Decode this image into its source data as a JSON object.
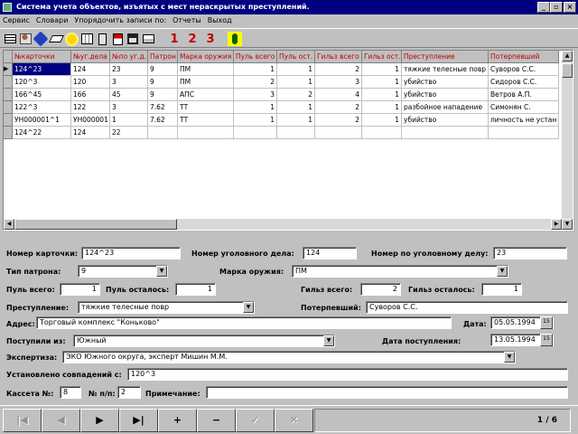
{
  "window": {
    "title": "Система учета объектов, изъятых с мест нераскрытых преступлений."
  },
  "menu": [
    "Сервис",
    "Словари",
    "Упорядочить записи по:",
    "Отчеты",
    "Выход"
  ],
  "grid": {
    "columns": [
      "№карточки",
      "№уг.дела",
      "№по уг.д.",
      "Патрон",
      "Марка оружия",
      "Пуль всего",
      "Пуль ост.",
      "Гильз всего",
      "Гильз ост.",
      "Преступление",
      "Потерпевший"
    ],
    "rows": [
      [
        "124^23",
        "124",
        "23",
        "9",
        "ПМ",
        "1",
        "1",
        "2",
        "1",
        "тяжкие телесные повр",
        "Суворов С.С."
      ],
      [
        "120^3",
        "120",
        "3",
        "9",
        "ПМ",
        "2",
        "1",
        "3",
        "1",
        "убийство",
        "Сидоров С.С."
      ],
      [
        "166^45",
        "166",
        "45",
        "9",
        "АПС",
        "3",
        "2",
        "4",
        "1",
        "убийство",
        "Ветров А.П."
      ],
      [
        "122^3",
        "122",
        "3",
        "7.62",
        "ТТ",
        "1",
        "1",
        "2",
        "1",
        "разбойное нападение",
        "Симонян С."
      ],
      [
        "УН000001^1",
        "УН000001",
        "1",
        "7.62",
        "ТТ",
        "1",
        "1",
        "2",
        "1",
        "убийство",
        "личность не устан"
      ],
      [
        "124^22",
        "124",
        "22",
        "",
        "",
        "",
        "",
        "",
        "",
        "",
        ""
      ]
    ]
  },
  "form": {
    "card_no": {
      "label": "Номер карточки:",
      "value": "124^23"
    },
    "case_no": {
      "label": "Номер уголовного дела:",
      "value": "124"
    },
    "num_in_case": {
      "label": "Номер по уголовному делу:",
      "value": "23"
    },
    "cartridge": {
      "label": "Тип патрона:",
      "value": "9"
    },
    "weapon": {
      "label": "Марка оружия:",
      "value": "ПМ"
    },
    "bullets_total": {
      "label": "Пуль всего:",
      "value": "1"
    },
    "bullets_left": {
      "label": "Пуль осталось:",
      "value": "1"
    },
    "shells_total": {
      "label": "Гильз всего:",
      "value": "2"
    },
    "shells_left": {
      "label": "Гильз осталось:",
      "value": "1"
    },
    "crime": {
      "label": "Преступление:",
      "value": "тяжкие телесные повр"
    },
    "victim": {
      "label": "Потерпевший:",
      "value": "Суворов С.С."
    },
    "address": {
      "label": "Адрес:",
      "value": "Торговый комплекс \"Коньково\""
    },
    "date": {
      "label": "Дата:",
      "value": "05.05.1994"
    },
    "received_from": {
      "label": "Поступили из:",
      "value": "Южный"
    },
    "received_date": {
      "label": "Дата поступления:",
      "value": "13.05.1994"
    },
    "expertise": {
      "label": "Экспертиза:",
      "value": "ЭКО Южного округа, эксперт Мишин М.М."
    },
    "matches": {
      "label": "Установлено совпадений с:",
      "value": "120^3"
    },
    "cassette": {
      "label": "Кассета №:",
      "value": "8"
    },
    "pos": {
      "label": "№ п/п:",
      "value": "2"
    },
    "note": {
      "label": "Примечание:",
      "value": ""
    }
  },
  "nav": {
    "first": "|◀",
    "prior": "◀",
    "next": "▶",
    "last": "▶|",
    "insert": "+",
    "delete": "−",
    "post": "✓",
    "cancel": "✕",
    "page": "1 / 6"
  },
  "toolbar": {
    "icons": [
      "table-icon",
      "people-icon",
      "edit-icon",
      "eraser-icon",
      "sun-icon",
      "calendar-icon",
      "calculator-icon",
      "document-icon",
      "save-icon",
      "print-icon",
      "report-1-icon",
      "report-2-icon",
      "report-3-icon",
      "runner-icon"
    ],
    "report_labels": [
      "1",
      "2",
      "3"
    ]
  }
}
